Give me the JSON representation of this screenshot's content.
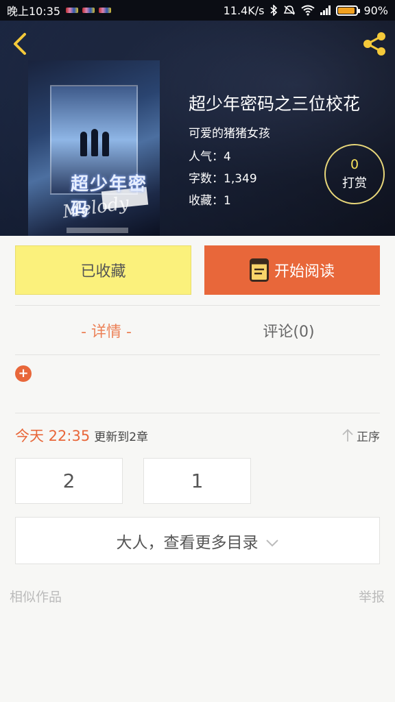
{
  "status_bar": {
    "time": "晚上10:35",
    "network_speed": "11.4K/s",
    "battery_percent": "90%",
    "battery_level": 0.9
  },
  "book": {
    "title": "超少年密码之三位校花",
    "author": "可爱的猪猪女孩",
    "popularity": "人气：4",
    "word_count": "字数：1,349",
    "favorites": "收藏：1",
    "cover_title": "超少年密码",
    "cover_script": "Melody"
  },
  "tip": {
    "count": "0",
    "label": "打赏"
  },
  "actions": {
    "collected_label": "已收藏",
    "read_label": "开始阅读"
  },
  "tabs": [
    {
      "label": "- 详情 -",
      "active": true
    },
    {
      "label": "评论(0)",
      "active": false
    }
  ],
  "expand_symbol": "+",
  "update": {
    "time": "今天 22:35",
    "text": "更新到2章",
    "sort_label": "正序"
  },
  "chapters": [
    "2",
    "1"
  ],
  "more_toc_label": "大人，查看更多目录",
  "similar_label": "相似作品",
  "report_label": "举报",
  "colors": {
    "accent": "#e8673a",
    "collected_bg": "#fbf17c",
    "tip_count": "#f6e15c"
  }
}
